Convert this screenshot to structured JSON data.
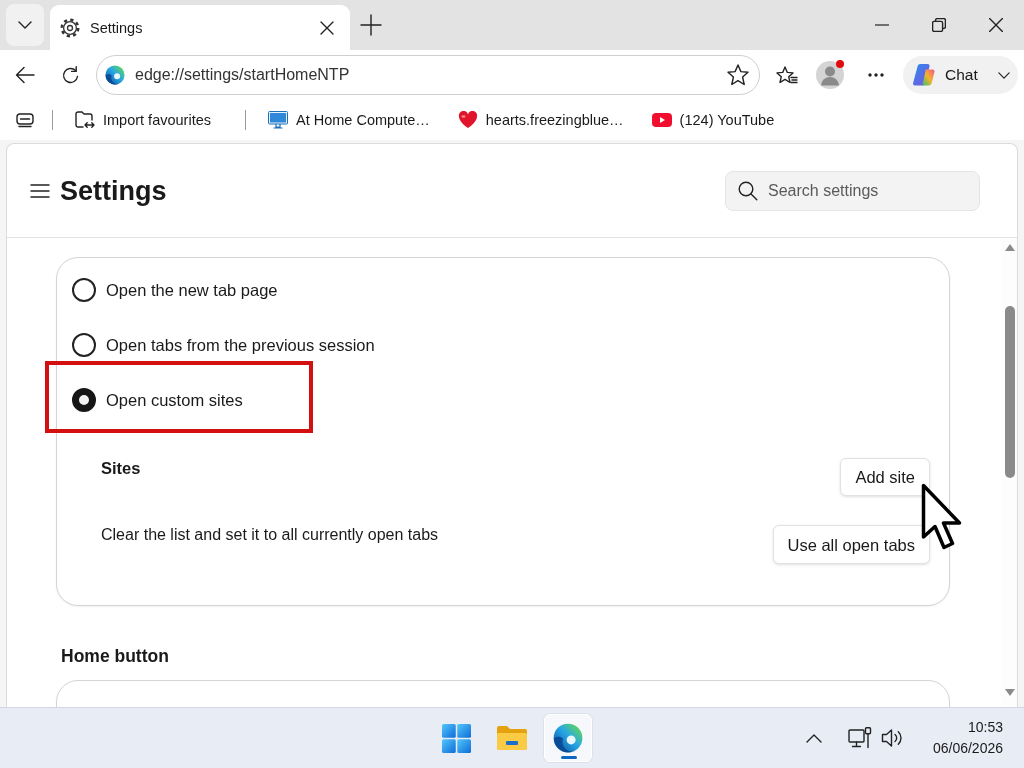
{
  "browser": {
    "tabs": [
      {
        "title": "Settings",
        "selected": true
      }
    ],
    "address_bar": {
      "url": "edge://settings/startHomeNTP"
    },
    "profile": {
      "notification": true
    },
    "chat_button": {
      "label": "Chat"
    },
    "favourites_bar": [
      {
        "label": "Import favourites",
        "kind": "import"
      },
      {
        "label": "At Home Compute…",
        "kind": "monitor"
      },
      {
        "label": "hearts.freezingblue…",
        "kind": "heart"
      },
      {
        "label": "(124) YouTube",
        "kind": "video"
      }
    ]
  },
  "settings": {
    "title": "Settings",
    "search": {
      "placeholder": "Search settings"
    },
    "startup": {
      "options": [
        {
          "label": "Open the new tab page",
          "selected": false,
          "highlighted": false
        },
        {
          "label": "Open tabs from the previous session",
          "selected": false,
          "highlighted": false
        },
        {
          "label": "Open custom sites",
          "selected": true,
          "highlighted": true
        }
      ],
      "sites": {
        "heading": "Sites",
        "button": "Add site"
      },
      "open_tabs": {
        "text": "Clear the list and set it to all currently open tabs",
        "button": "Use all open tabs"
      }
    },
    "home_button": {
      "heading": "Home button"
    }
  },
  "taskbar": {
    "apps": [
      {
        "kind": "start",
        "active": false
      },
      {
        "kind": "files",
        "active": false
      },
      {
        "kind": "browser",
        "active": true
      }
    ],
    "time": "10:53",
    "date": "06/06/2026"
  }
}
